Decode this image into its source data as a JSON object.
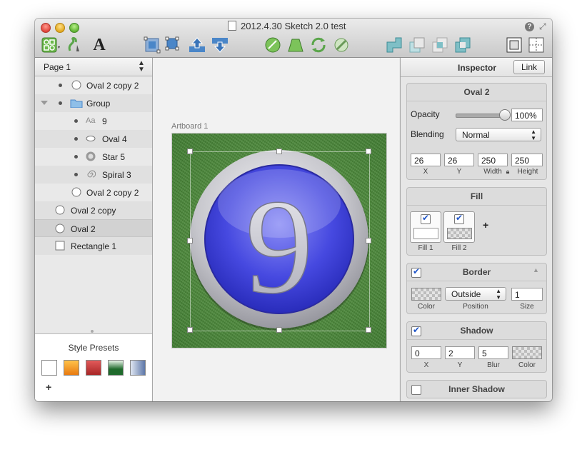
{
  "window": {
    "title": "2012.4.30 Sketch 2.0 test"
  },
  "sidebar": {
    "page_selector": "Page 1",
    "layers": [
      {
        "name": "Oval 2 copy 2",
        "icon": "oval-outline-icon"
      },
      {
        "name": "Group",
        "icon": "folder-icon"
      },
      {
        "name": "9",
        "icon": "text-aa-icon",
        "icon_text": "Aa"
      },
      {
        "name": "Oval 4",
        "icon": "small-oval-icon"
      },
      {
        "name": "Star 5",
        "icon": "star-icon"
      },
      {
        "name": "Spiral 3",
        "icon": "spiral-icon"
      },
      {
        "name": "Oval 2 copy 2",
        "icon": "oval-outline-icon"
      },
      {
        "name": "Oval 2 copy",
        "icon": "oval-outline-icon"
      },
      {
        "name": "Oval 2",
        "icon": "oval-outline-icon",
        "selected": true
      },
      {
        "name": "Rectangle 1",
        "icon": "rectangle-icon"
      }
    ],
    "style_presets": {
      "title": "Style Presets",
      "add_label": "+"
    }
  },
  "canvas": {
    "artboard_label": "Artboard 1",
    "glyph": "9"
  },
  "inspector": {
    "title": "Inspector",
    "link_button": "Link",
    "layer_name": "Oval 2",
    "opacity_label": "Opacity",
    "opacity_value": "100%",
    "opacity_level": 1.0,
    "blending_label": "Blending",
    "blending_value": "Normal",
    "position": {
      "x": "26",
      "y": "26",
      "width": "250",
      "height": "250"
    },
    "position_labels": {
      "x": "X",
      "y": "Y",
      "width": "Width",
      "height": "Height"
    },
    "fill": {
      "title": "Fill",
      "fill1": "Fill 1",
      "fill2": "Fill 2",
      "add": "+"
    },
    "border": {
      "title": "Border",
      "color_label": "Color",
      "position_label": "Position",
      "size_label": "Size",
      "position_value": "Outside",
      "size_value": "1"
    },
    "shadow": {
      "title": "Shadow",
      "x": "0",
      "y": "2",
      "blur": "5",
      "x_label": "X",
      "y_label": "Y",
      "blur_label": "Blur",
      "color_label": "Color"
    },
    "inner_shadow": {
      "title": "Inner Shadow"
    }
  },
  "colors": {
    "glyph_blue": "#3c3fd9",
    "ring_silver": "#c9c9cf",
    "grass": "#4b8a3a",
    "toolbar_blue": "#4a86c8",
    "toolbar_green": "#5aa54a"
  },
  "swatches": [
    "#ffffff",
    "#f39a1c",
    "#c53a3a",
    "#2e7a3c",
    "#7f93b8"
  ]
}
